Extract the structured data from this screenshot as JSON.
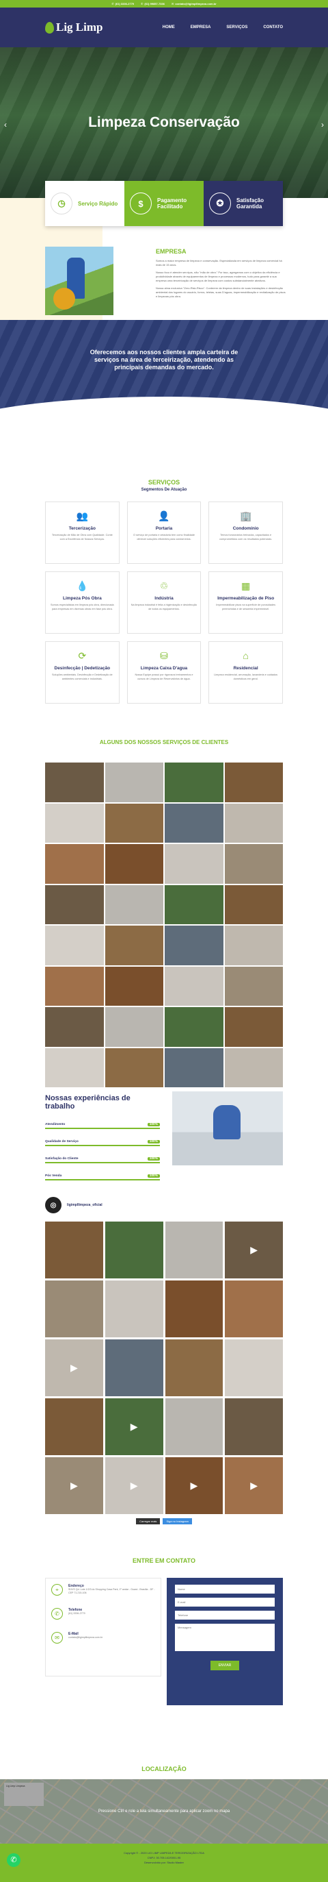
{
  "topbar": {
    "phone1": "(61) 3336-2779",
    "phone2": "(61) 99857-7336",
    "email": "contato@ligimpllimpeza.com.br"
  },
  "header": {
    "logo": "Lig Limp",
    "nav": [
      "HOME",
      "EMPRESA",
      "SERVIÇOS",
      "CONTATO"
    ]
  },
  "hero": {
    "title": "Limpeza Conservação",
    "prev": "‹",
    "next": "›"
  },
  "features": [
    {
      "icon": "clock-icon",
      "glyph": "◷",
      "label": "Serviço Rápido"
    },
    {
      "icon": "money-icon",
      "glyph": "$",
      "label": "Pagamento Facilitado"
    },
    {
      "icon": "medal-icon",
      "glyph": "✪",
      "label": "Satisfação Garantida"
    }
  ],
  "empresa": {
    "title": "EMPRESA",
    "p1": "Somos a maior empresa de limpeza e conservação. Especializada em serviços de limpeza comercial há mais de 15 anos.",
    "p2": "Nosso foco é atender serviços, não \"mão de obra.\" Por isso, agregamos com o objetivo da eficiência e produtividade através de equipamentos de limpeza e processos modernos, tudo para garantir a sua empresa uma terceirização de serviços de limpeza com custos substancialmente atrativos.",
    "p3": "Nossa alma exclusiva \"Zero-Risk-Risco\". Conterem da limpeza dentro de suas instalações e desinfecção ambiental dos lugares do usuário, forros, teleias, suas D'aguas, impermeabilização e revitalização de pisos e limpezas pós obra."
  },
  "banner": {
    "text": "Oferecemos aos nossos clientes ampla carteira de serviços na área de terceirização, atendendo às principais demandas do mercado."
  },
  "servicos": {
    "title": "SERVIÇOS",
    "subtitle": "Segmentos De Atuação",
    "items": [
      {
        "icon": "people-icon",
        "glyph": "👥",
        "title": "Tercerização",
        "text": "Tercerização de Mão de Obra com Qualidade. Conte com a Excelência de Nossos Serviços."
      },
      {
        "icon": "guard-icon",
        "glyph": "👤",
        "title": "Portaria",
        "text": "O serviço de portaria e zeladoria tem como finalidade oferecer soluções eficientes para condomínios."
      },
      {
        "icon": "building-icon",
        "glyph": "🏢",
        "title": "Condomínio",
        "text": "Temos funcionários treinados, capacitados e comprometidos com os resultados potenciais."
      },
      {
        "icon": "drop-icon",
        "glyph": "💧",
        "title": "Limpeza Pós Obra",
        "text": "Somos especialistas em limpeza pós obra, direcionada para empresas em diversas obras em fase pós obra."
      },
      {
        "icon": "factory-icon",
        "glyph": "♲",
        "title": "Indústria",
        "text": "Na limpeza industrial é feita a higienização e desinfecção de todos os equipamentos."
      },
      {
        "icon": "floor-icon",
        "glyph": "▦",
        "title": "Impermeabilização de Piso",
        "text": "Impermeabilizar pisos na superfície de porosidades preenchidas e de sessenta impermeável."
      },
      {
        "icon": "recycle-icon",
        "glyph": "⟳",
        "title": "Desinfecção | Dedetização",
        "text": "Soluções ambientais. Desinfecção e Dedetização de ambientes comerciais e industriais."
      },
      {
        "icon": "water-tank-icon",
        "glyph": "⛁",
        "title": "Limpeza Caixa D'agua",
        "text": "Nossa Equipe possui por rigorosos treinamentos e cursos de Limpeza de Reservatórios de água."
      },
      {
        "icon": "home-icon",
        "glyph": "⌂",
        "title": "Residencial",
        "text": "Limpeza residencial, arrumação, lavanderia e cuidados domésticos em geral."
      }
    ]
  },
  "portfolio": {
    "title": "ALGUNS DOS NOSSOS SERVIÇOS DE CLIENTES"
  },
  "experiencia": {
    "title": "Nossas experiências de trabalho",
    "bars": [
      {
        "label": "Atendimento",
        "pct": 100,
        "pct_label": "100%"
      },
      {
        "label": "Qualidade de Serviço",
        "pct": 100,
        "pct_label": "100%"
      },
      {
        "label": "Satisfação do Cliente",
        "pct": 100,
        "pct_label": "100%"
      },
      {
        "label": "Pós Venda",
        "pct": 100,
        "pct_label": "100%"
      }
    ]
  },
  "instagram": {
    "handle": "ligimpllimpeza_oficial",
    "load_more": "Carregar mais",
    "follow": "Siga no Instagram"
  },
  "contato": {
    "title": "ENTRE EM CONTATO",
    "endereco_label": "Endereço",
    "endereco": "SHVS Qd. Lote 1/2/3 do Shopping Casa Park, 1º andar - Guará - Brasília - DF - CEP 71.215-106",
    "telefone_label": "Telefone",
    "telefone": "(61) 3336-2779",
    "email_label": "E-Mail",
    "email": "contato@ligimpllimpeza.com.br",
    "form": {
      "nome": "Nome",
      "email": "E-mail",
      "telefone": "Telefone",
      "mensagem": "Mensagem",
      "enviar": "ENVIAR"
    }
  },
  "localizacao": {
    "title": "LOCALIZAÇÃO",
    "overlay": "Pressione Ctrl e role a tela simultaneamente para aplicar zoom no mapa",
    "map_card": "Lig Limp Limpeza"
  },
  "footer": {
    "line1": "Copyright © - 2020 LIG LIMP LIMPEZA E TERCEIRIZAÇÃO LTDA",
    "line2": "CNPJ: 30.705.142/0001-95",
    "line3": "Desenvolvido por: Studio Master"
  },
  "colors": {
    "green": "#7dbb2a",
    "navy": "#2e3366"
  }
}
